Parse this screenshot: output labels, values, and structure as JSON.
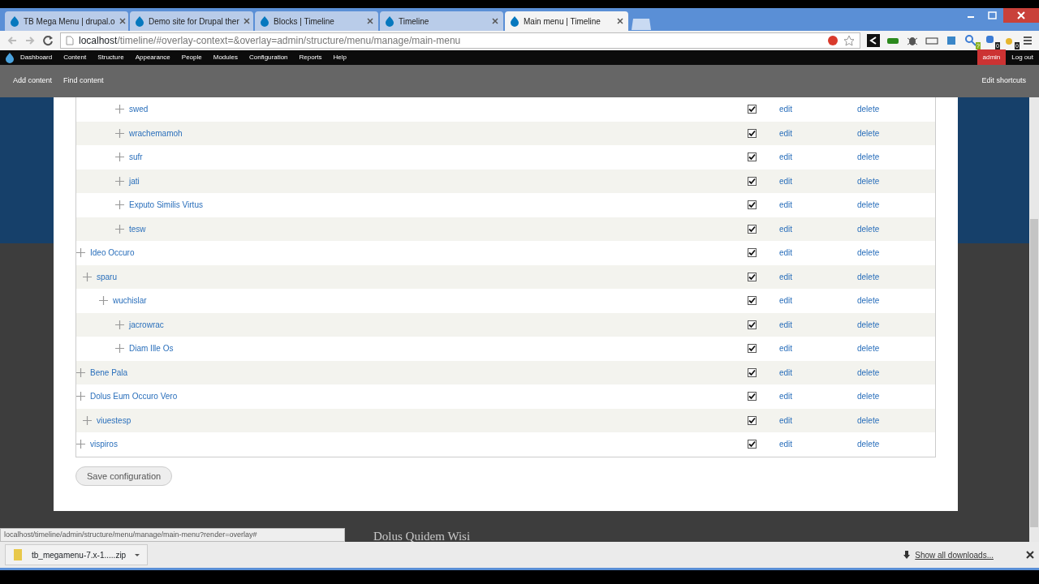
{
  "tabs": [
    {
      "label": "TB Mega Menu | drupal.o",
      "selected": false
    },
    {
      "label": "Demo site for Drupal ther",
      "selected": false
    },
    {
      "label": "Blocks | Timeline",
      "selected": false
    },
    {
      "label": "Timeline",
      "selected": false
    },
    {
      "label": "Main menu | Timeline",
      "selected": true
    }
  ],
  "address": {
    "host": "localhost",
    "path": "/timeline/#overlay-context=&overlay=admin/structure/menu/manage/main-menu"
  },
  "extension_badges": [
    "?",
    "0",
    "0"
  ],
  "admin_menu": {
    "items": [
      "Dashboard",
      "Content",
      "Structure",
      "Appearance",
      "People",
      "Modules",
      "Configuration",
      "Reports",
      "Help"
    ],
    "user": "admin",
    "logout": "Log out"
  },
  "shortcuts": {
    "items": [
      "Add content",
      "Find content"
    ],
    "edit": "Edit shortcuts"
  },
  "menu_tree": [
    {
      "children": [
        {
          "children": [
            {
              "children": [
                {
                  "label": "swed",
                  "enabled": true,
                  "edit": "edit",
                  "delete": "delete"
                },
                {
                  "label": "wrachemamoh",
                  "enabled": true,
                  "edit": "edit",
                  "delete": "delete"
                },
                {
                  "label": "sufr",
                  "enabled": true,
                  "edit": "edit",
                  "delete": "delete"
                },
                {
                  "label": "jati",
                  "enabled": true,
                  "edit": "edit",
                  "delete": "delete"
                },
                {
                  "label": "Exputo Similis Virtus",
                  "enabled": true,
                  "edit": "edit",
                  "delete": "delete"
                },
                {
                  "label": "tesw",
                  "enabled": true,
                  "edit": "edit",
                  "delete": "delete"
                }
              ]
            }
          ]
        }
      ]
    },
    {
      "label": "Ideo Occuro",
      "enabled": true,
      "edit": "edit",
      "delete": "delete",
      "children": [
        {
          "label": "sparu",
          "enabled": true,
          "edit": "edit",
          "delete": "delete",
          "children": [
            {
              "label": "wuchislar",
              "enabled": true,
              "edit": "edit",
              "delete": "delete",
              "children": [
                {
                  "label": "jacrowrac",
                  "enabled": true,
                  "edit": "edit",
                  "delete": "delete"
                },
                {
                  "label": "Diam Ille Os",
                  "enabled": true,
                  "edit": "edit",
                  "delete": "delete"
                }
              ]
            }
          ]
        }
      ]
    },
    {
      "label": "Bene Pala",
      "enabled": true,
      "edit": "edit",
      "delete": "delete"
    },
    {
      "label": "Dolus Eum Occuro Vero",
      "enabled": true,
      "edit": "edit",
      "delete": "delete",
      "children": [
        {
          "label": "viuestesp",
          "enabled": true,
          "edit": "edit",
          "delete": "delete"
        }
      ]
    },
    {
      "label": "vispiros",
      "enabled": true,
      "edit": "edit",
      "delete": "delete"
    }
  ],
  "save_button": "Save configuration",
  "background_heading": "Dolus Quidem Wisi",
  "status_url": "localhost/timeline/admin/structure/menu/manage/main-menu?render=overlay#",
  "download": {
    "file": "tb_megamenu-7.x-1.....zip",
    "show_all": "Show all downloads..."
  }
}
